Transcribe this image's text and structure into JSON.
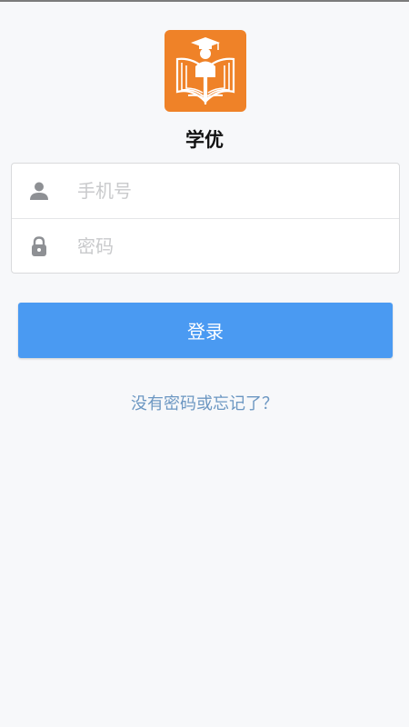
{
  "app": {
    "name": "学优"
  },
  "form": {
    "phone": {
      "placeholder": "手机号",
      "value": ""
    },
    "password": {
      "placeholder": "密码",
      "value": ""
    }
  },
  "login_button": {
    "label": "登录"
  },
  "forgot_link": {
    "label": "没有密码或忘记了？"
  },
  "colors": {
    "logo_background": "#ef8228",
    "primary_button": "#4a9af2",
    "link": "#6c97c2",
    "page_background": "#f7f8fa"
  },
  "icons": {
    "logo": "graduate-book-logo",
    "phone_field": "user-icon",
    "password_field": "lock-icon"
  }
}
